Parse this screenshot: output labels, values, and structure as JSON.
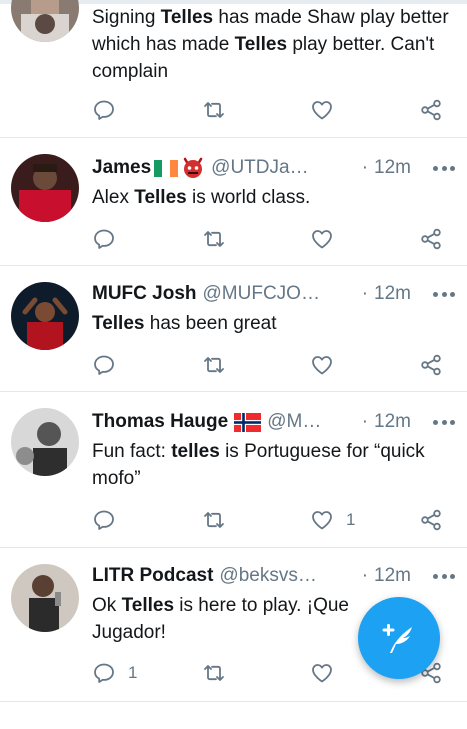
{
  "colors": {
    "accent": "#1da1f2",
    "text": "#14171a",
    "muted": "#657786",
    "divider": "#e1e8ed"
  },
  "icons": {
    "reply": "reply-icon",
    "retweet": "retweet-icon",
    "like": "heart-icon",
    "share": "share-icon",
    "more": "more-icon",
    "compose": "compose-tweet-icon"
  },
  "tweets": [
    {
      "name": "",
      "handle": "",
      "time": "",
      "text_parts": [
        "Signing ",
        "Telles",
        " has made Shaw play better which has made ",
        "Telles",
        " play better. Can't complain"
      ],
      "replies": "",
      "likes": ""
    },
    {
      "name": "James",
      "handle": "@UTDJa…",
      "time": "12m",
      "badges": [
        "ireland-flag-emoji",
        "red-devil-emoji"
      ],
      "text_parts": [
        "Alex ",
        "Telles",
        " is world class."
      ],
      "replies": "",
      "likes": ""
    },
    {
      "name": "MUFC Josh",
      "handle": "@MUFCJO…",
      "time": "12m",
      "text_parts": [
        "Telles",
        " has been great"
      ],
      "replies": "",
      "likes": ""
    },
    {
      "name": "Thomas Hauge",
      "handle": "@M…",
      "time": "12m",
      "badges": [
        "norway-flag-emoji"
      ],
      "text_parts": [
        "Fun fact: ",
        "telles",
        " is Portuguese for “quick mofo”"
      ],
      "replies": "",
      "likes": "1"
    },
    {
      "name": "LITR Podcast",
      "handle": "@beksvs…",
      "time": "12m",
      "text_parts": [
        "Ok ",
        "Telles",
        " is here to play. ¡Que Jugador!"
      ],
      "replies": "1",
      "likes": ""
    }
  ],
  "separator": "·"
}
